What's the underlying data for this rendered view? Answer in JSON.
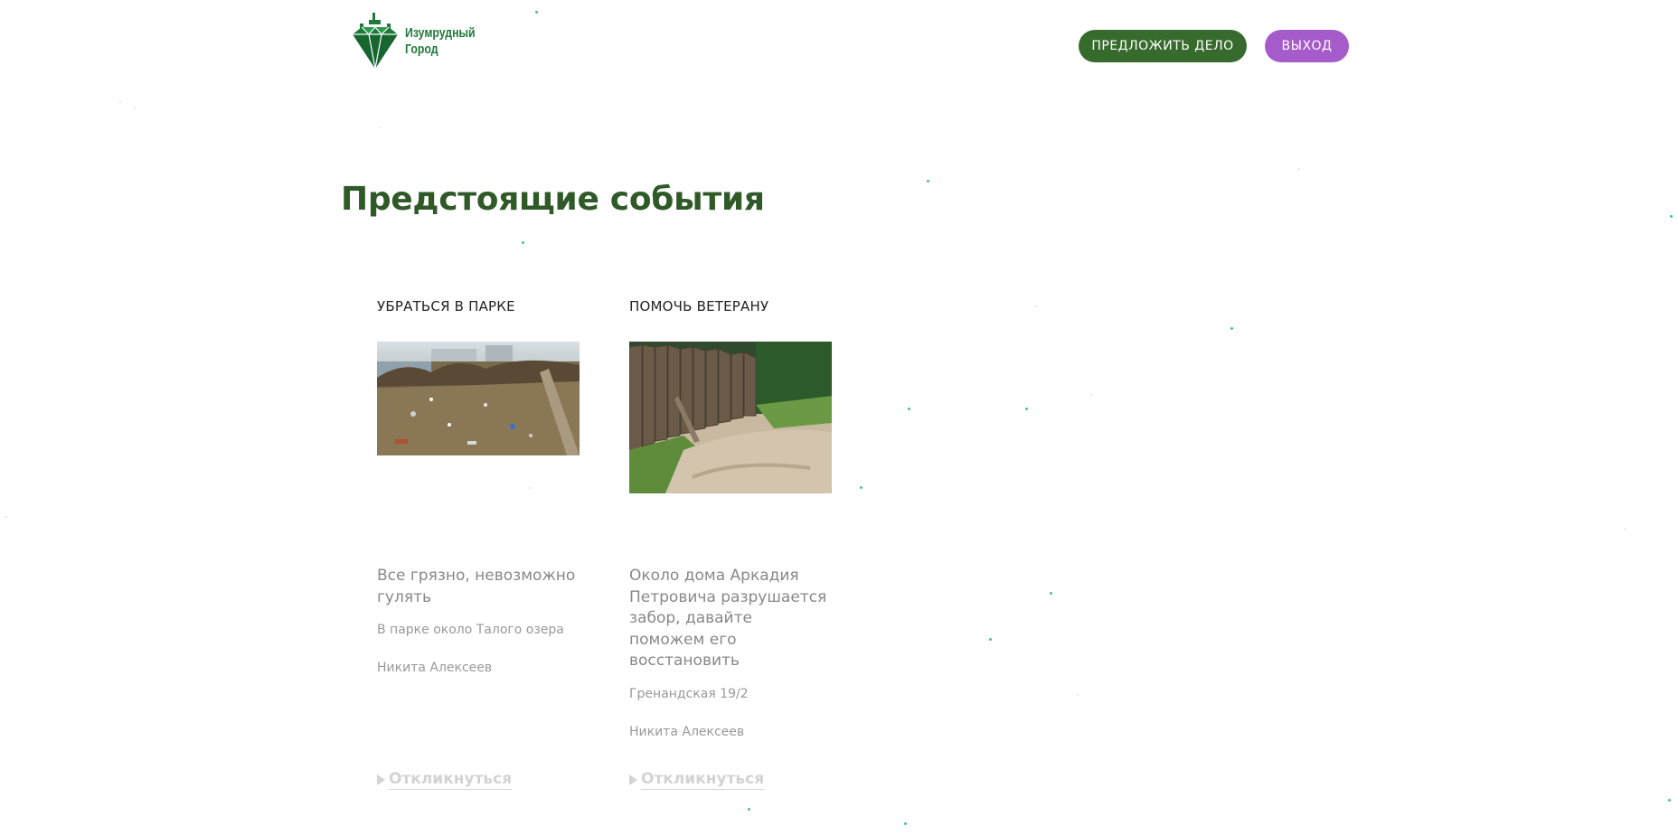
{
  "header": {
    "logo_line1": "Изумрудный",
    "logo_line2": "Город",
    "propose_button": "ПРЕДЛОЖИТЬ ДЕЛО",
    "exit_button": "ВЫХОД"
  },
  "main": {
    "title": "Предстоящие события",
    "events": [
      {
        "title": "УБРАТЬСЯ В ПАРКЕ",
        "description": "Все грязно, невозможно гулять",
        "place": "В парке около Талого озера",
        "author": "Никита Алексеев",
        "respond_label": "Откликнуться"
      },
      {
        "title": "ПОМОЧЬ ВЕТЕРАНУ",
        "description": "Около дома Аркадия Петровича разрушается забор, давайте поможем его восстановить",
        "place": "Гренандская 19/2",
        "author": "Никита Алексеев",
        "respond_label": "Откликнуться"
      }
    ]
  },
  "colors": {
    "brand_green": "#366b2d",
    "title_green": "#2f5a28",
    "logout_purple": "#a65bcb",
    "particle": "#2fb8a0"
  }
}
